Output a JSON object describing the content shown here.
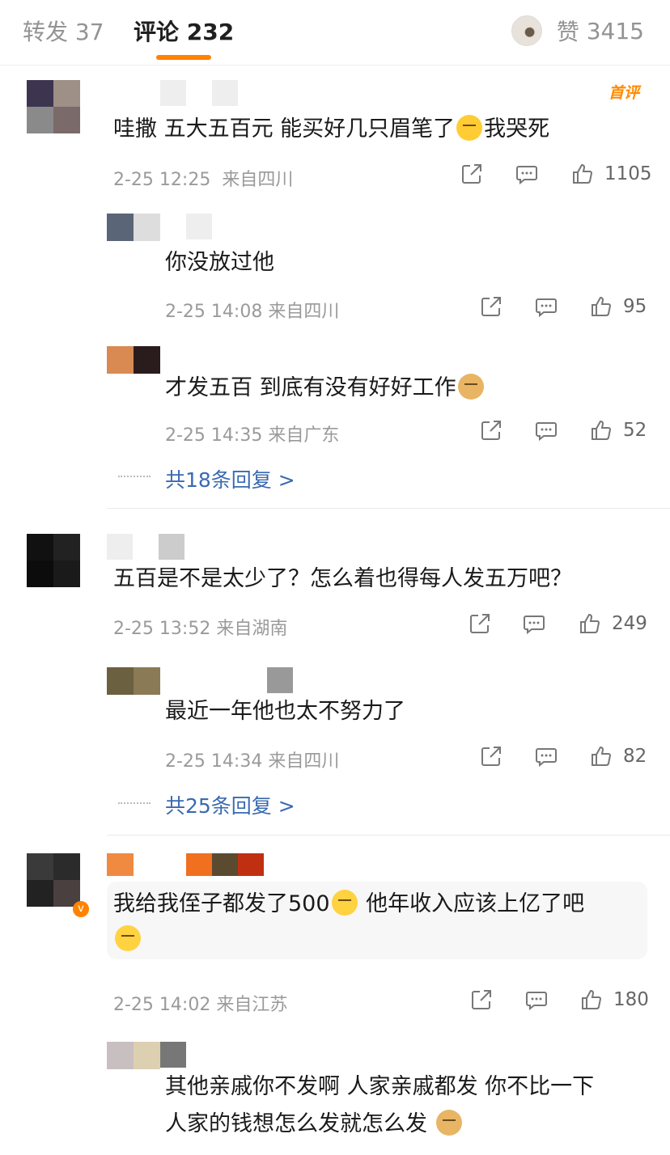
{
  "tabs": {
    "repost_label": "转发",
    "repost_count": "37",
    "comment_label": "评论",
    "comment_count": "232",
    "like_label": "赞",
    "like_count": "3415"
  },
  "colors": {
    "accent": "#ff8200",
    "link": "#3a6ab0",
    "meta": "#9a9a9a"
  },
  "comments": [
    {
      "badge": "首评",
      "text": "哇撒 五大五百元 能买好几只眉笔了",
      "text_tail": "我哭死",
      "emoji": "crying-face",
      "time": "2-25 12:25",
      "location": "来自四川",
      "likes": "1105",
      "replies": [
        {
          "text": "你没放过他",
          "time": "2-25 14:08",
          "location": "来自四川",
          "likes": "95"
        },
        {
          "text": "才发五百 到底有没有好好工作",
          "emoji": "doge",
          "time": "2-25 14:35",
          "location": "来自广东",
          "likes": "52"
        }
      ],
      "more_replies": "共18条回复 >"
    },
    {
      "text": "五百是不是太少了？怎么着也得每人发五万吧？",
      "time": "2-25 13:52",
      "location": "来自湖南",
      "likes": "249",
      "replies": [
        {
          "text": "最近一年他也太不努力了",
          "time": "2-25 14:34",
          "location": "来自四川",
          "likes": "82"
        }
      ],
      "more_replies": "共25条回复 >"
    },
    {
      "text": "我给我侄子都发了500",
      "text_mid": "他年收入应该上亿了吧",
      "emoji": "speechless",
      "emoji2": "sweat",
      "time": "2-25 14:02",
      "location": "来自江苏",
      "likes": "180",
      "replies": [
        {
          "text_line1": "其他亲戚你不发啊 人家亲戚都发 你不比一下",
          "text_line2": "人家的钱想怎么发就怎么发",
          "emoji": "doge"
        }
      ]
    }
  ]
}
